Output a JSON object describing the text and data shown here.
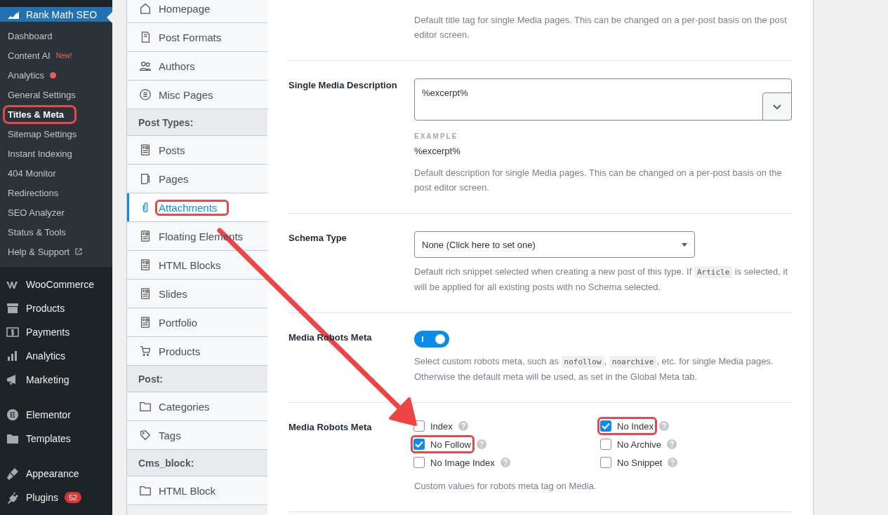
{
  "admin_menu": {
    "plugin": {
      "title": "Rank Math SEO",
      "submenu": [
        {
          "label": "Dashboard",
          "selected": false,
          "highlighted": false
        },
        {
          "label": "Content AI",
          "badge": "New!",
          "selected": false,
          "highlighted": false
        },
        {
          "label": "Analytics",
          "dot": true,
          "selected": false,
          "highlighted": false
        },
        {
          "label": "General Settings",
          "selected": false,
          "highlighted": false
        },
        {
          "label": "Titles & Meta",
          "selected": true,
          "highlighted": true
        },
        {
          "label": "Sitemap Settings",
          "selected": false,
          "highlighted": false
        },
        {
          "label": "Instant Indexing",
          "selected": false,
          "highlighted": false
        },
        {
          "label": "404 Monitor",
          "selected": false,
          "highlighted": false
        },
        {
          "label": "Redirections",
          "selected": false,
          "highlighted": false
        },
        {
          "label": "SEO Analyzer",
          "selected": false,
          "highlighted": false
        },
        {
          "label": "Status & Tools",
          "selected": false,
          "highlighted": false
        },
        {
          "label": "Help & Support",
          "external": true,
          "selected": false,
          "highlighted": false
        }
      ]
    },
    "groups": [
      [
        {
          "label": "WooCommerce"
        },
        {
          "label": "Products"
        },
        {
          "label": "Payments"
        },
        {
          "label": "Analytics"
        },
        {
          "label": "Marketing"
        }
      ],
      [
        {
          "label": "Elementor"
        },
        {
          "label": "Templates"
        }
      ],
      [
        {
          "label": "Appearance"
        },
        {
          "label": "Plugins",
          "count": "52"
        }
      ]
    ]
  },
  "settings_nav": [
    {
      "kind": "item",
      "label": "Homepage",
      "selected": false,
      "highlighted": false
    },
    {
      "kind": "item",
      "label": "Post Formats",
      "selected": false,
      "highlighted": false
    },
    {
      "kind": "item",
      "label": "Authors",
      "selected": false,
      "highlighted": false
    },
    {
      "kind": "item",
      "label": "Misc Pages",
      "selected": false,
      "highlighted": false
    },
    {
      "kind": "heading",
      "label": "Post Types:"
    },
    {
      "kind": "item",
      "label": "Posts",
      "selected": false,
      "highlighted": false
    },
    {
      "kind": "item",
      "label": "Pages",
      "selected": false,
      "highlighted": false
    },
    {
      "kind": "item",
      "label": "Attachments",
      "selected": true,
      "highlighted": true
    },
    {
      "kind": "item",
      "label": "Floating Elements",
      "selected": false,
      "highlighted": false
    },
    {
      "kind": "item",
      "label": "HTML Blocks",
      "selected": false,
      "highlighted": false
    },
    {
      "kind": "item",
      "label": "Slides",
      "selected": false,
      "highlighted": false
    },
    {
      "kind": "item",
      "label": "Portfolio",
      "selected": false,
      "highlighted": false
    },
    {
      "kind": "item",
      "label": "Products",
      "selected": false,
      "highlighted": false
    },
    {
      "kind": "heading",
      "label": "Post:"
    },
    {
      "kind": "item",
      "label": "Categories",
      "selected": false,
      "highlighted": false
    },
    {
      "kind": "item",
      "label": "Tags",
      "selected": false,
      "highlighted": false
    },
    {
      "kind": "heading",
      "label": "Cms_block:"
    },
    {
      "kind": "item",
      "label": "HTML Block",
      "selected": false,
      "highlighted": false
    }
  ],
  "settings": [
    {
      "kind": "note",
      "description": "Default title tag for single Media pages. This can be changed on a per-post basis on the post editor screen."
    },
    {
      "kind": "textarea",
      "label": "Single Media Description",
      "value": "%excerpt%",
      "example_label": "EXAMPLE",
      "example": "%excerpt%",
      "description": "Default description for single Media pages. This can be changed on a per-post basis on the post editor screen."
    },
    {
      "kind": "select",
      "label": "Schema Type",
      "value": "None (Click here to set one)",
      "description_parts": [
        {
          "text": "Default rich snippet selected when creating a new post of this type. If ",
          "code": false
        },
        {
          "text": "Article",
          "code": true
        },
        {
          "text": " is selected, it will be applied for all existing posts with no Schema selected.",
          "code": false
        }
      ]
    },
    {
      "kind": "toggle",
      "label": "Media Robots Meta",
      "on": true,
      "description_parts": [
        {
          "text": "Select custom robots meta, such as ",
          "code": false
        },
        {
          "text": "nofollow",
          "code": true
        },
        {
          "text": ", ",
          "code": false
        },
        {
          "text": "noarchive",
          "code": true
        },
        {
          "text": ", etc. for single Media pages. Otherwise the default meta will be used, as set in the Global Meta tab.",
          "code": false
        }
      ]
    },
    {
      "kind": "checkboxes",
      "label": "Media Robots Meta",
      "options": [
        {
          "label": "Index",
          "checked": false,
          "highlighted": false
        },
        {
          "label": "No Follow",
          "checked": true,
          "highlighted": true
        },
        {
          "label": "No Image Index",
          "checked": false,
          "highlighted": false
        },
        {
          "label": "No Index",
          "checked": true,
          "highlighted": true
        },
        {
          "label": "No Archive",
          "checked": false,
          "highlighted": false
        },
        {
          "label": "No Snippet",
          "checked": false,
          "highlighted": false
        }
      ],
      "description": "Custom values for robots meta tag on Media."
    }
  ],
  "annotation": {
    "arrow": true
  }
}
